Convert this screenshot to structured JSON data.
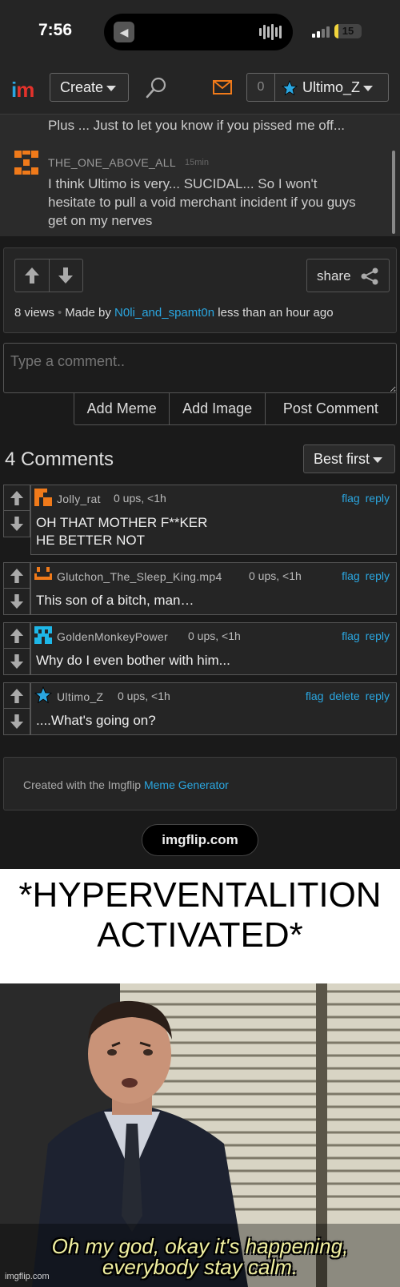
{
  "status_bar": {
    "time": "7:56",
    "battery": "15",
    "battery_level": 0.15
  },
  "nav": {
    "create_label": "Create",
    "notification_count": "0",
    "username": "Ultimo_Z"
  },
  "upper_comment": {
    "previous_line": "Plus ... Just to let you know if you pissed me off...",
    "username": "THE_ONE_ABOVE_ALL",
    "time": "15min",
    "text_line1": "I think Ultimo is very... SUCIDAL... So I won't",
    "text_line2": "hesitate to pull a void merchant incident if you guys",
    "text_line3": "get on my nerves"
  },
  "post_info": {
    "share_label": "share",
    "views": "8 views",
    "made_by_prefix": "Made by",
    "author": "N0li_and_spamt0n",
    "made_by_suffix": "less than an hour ago"
  },
  "comment_form": {
    "placeholder": "Type a comment..",
    "add_meme": "Add Meme",
    "add_image": "Add Image",
    "post_comment": "Post Comment"
  },
  "comments_header": {
    "count_label": "4 Comments",
    "sort_label": "Best first"
  },
  "comments": [
    {
      "user": "Jolly_rat",
      "ups": "0 ups, <1h",
      "flag": "flag",
      "reply": "reply",
      "line1": "OH THAT MOTHER F**KER",
      "line2": "HE BETTER NOT",
      "avatar_color": "#f07a1a"
    },
    {
      "user": "Glutchon_The_Sleep_King.mp4",
      "ups": "0 ups, <1h",
      "flag": "flag",
      "reply": "reply",
      "line1": "This son of a bitch, man…",
      "avatar_color": "#f07a1a"
    },
    {
      "user": "GoldenMonkeyPower",
      "ups": "0 ups, <1h",
      "flag": "flag",
      "reply": "reply",
      "line1": "Why do I even bother with him...",
      "avatar_color": "#1eb7e8"
    },
    {
      "user": "Ultimo_Z",
      "ups": "0 ups, <1h",
      "flag": "flag",
      "delete": "delete",
      "reply": "reply",
      "line1": "....What's going on?",
      "avatar_color": "#2aa6e0"
    }
  ],
  "footer": {
    "created_with": "Created with the Imgflip",
    "generator_link": "Meme Generator",
    "site_pill": "imgflip.com"
  },
  "meme": {
    "caption_line1": "*HYPERVENTALITION",
    "caption_line2": "ACTIVATED*",
    "subtitle_line1": "Oh my god, okay it's happening,",
    "subtitle_line2": "everybody stay calm.",
    "watermark": "imgflip.com"
  },
  "colors": {
    "accent_blue": "#2aa6e0",
    "mail_orange": "#f07a1a",
    "logo_red": "#e4322b"
  }
}
